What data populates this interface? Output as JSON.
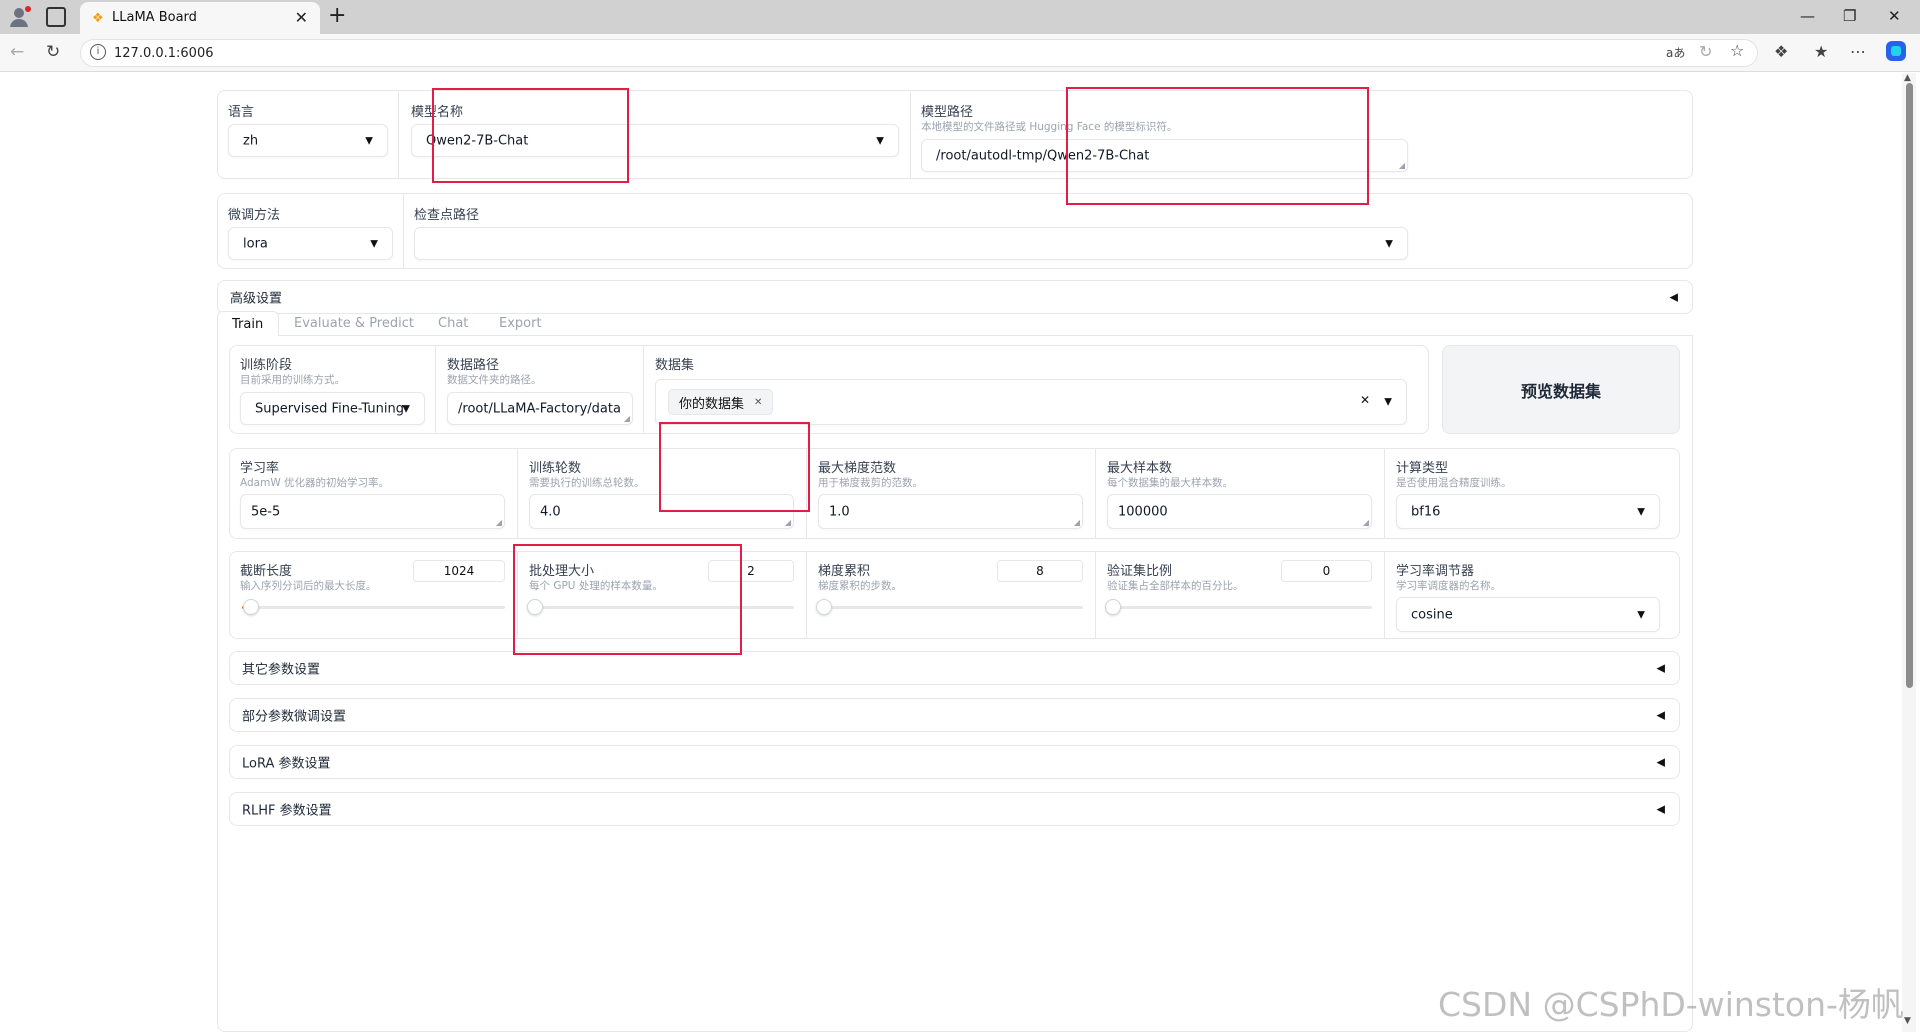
{
  "browser": {
    "tab_title": "LLaMA Board",
    "url": "127.0.0.1:6006"
  },
  "top_row": {
    "lang_label": "语言",
    "lang_value": "zh",
    "model_name_label": "模型名称",
    "model_name_value": "Qwen2-7B-Chat",
    "model_path_label": "模型路径",
    "model_path_info": "本地模型的文件路径或 Hugging Face 的模型标识符。",
    "model_path_value": "/root/autodl-tmp/Qwen2-7B-Chat"
  },
  "second_row": {
    "finetune_label": "微调方法",
    "finetune_value": "lora",
    "checkpoint_label": "检查点路径",
    "checkpoint_value": ""
  },
  "advanced": {
    "label": "高级设置"
  },
  "tabs": [
    "Train",
    "Evaluate & Predict",
    "Chat",
    "Export"
  ],
  "train": {
    "stage_label": "训练阶段",
    "stage_info": "目前采用的训练方式。",
    "stage_value": "Supervised Fine-Tuning",
    "data_dir_label": "数据路径",
    "data_dir_info": "数据文件夹的路径。",
    "data_dir_value": "/root/LLaMA-Factory/data",
    "dataset_label": "数据集",
    "dataset_chip": "你的数据集",
    "preview_button": "预览数据集",
    "lr_label": "学习率",
    "lr_info": "AdamW 优化器的初始学习率。",
    "lr_value": "5e-5",
    "epochs_label": "训练轮数",
    "epochs_info": "需要执行的训练总轮数。",
    "epochs_value": "4.0",
    "max_grad_label": "最大梯度范数",
    "max_grad_info": "用于梯度裁剪的范数。",
    "max_grad_value": "1.0",
    "max_samples_label": "最大样本数",
    "max_samples_info": "每个数据集的最大样本数。",
    "max_samples_value": "100000",
    "compute_label": "计算类型",
    "compute_info": "是否使用混合精度训练。",
    "compute_value": "bf16",
    "cutoff_label": "截断长度",
    "cutoff_info": "输入序列分词后的最大长度。",
    "cutoff_value": "1024",
    "cutoff_fraction": 0.02,
    "batch_label": "批处理大小",
    "batch_info": "每个 GPU 处理的样本数量。",
    "batch_value": "2",
    "batch_fraction": 0.0,
    "grad_accum_label": "梯度累积",
    "grad_accum_info": "梯度累积的步数。",
    "grad_accum_value": "8",
    "grad_accum_fraction": 0.0,
    "val_label": "验证集比例",
    "val_info": "验证集占全部样本的百分比。",
    "val_value": "0",
    "val_fraction": 0.0,
    "scheduler_label": "学习率调节器",
    "scheduler_info": "学习率调度器的名称。",
    "scheduler_value": "cosine"
  },
  "accordions": [
    "其它参数设置",
    "部分参数微调设置",
    "LoRA 参数设置",
    "RLHF 参数设置"
  ],
  "watermark": "CSDN @CSPhD-winston-杨帆",
  "colors": {
    "highlight_box": "#e11d48",
    "slider_accent": "#f97316"
  }
}
